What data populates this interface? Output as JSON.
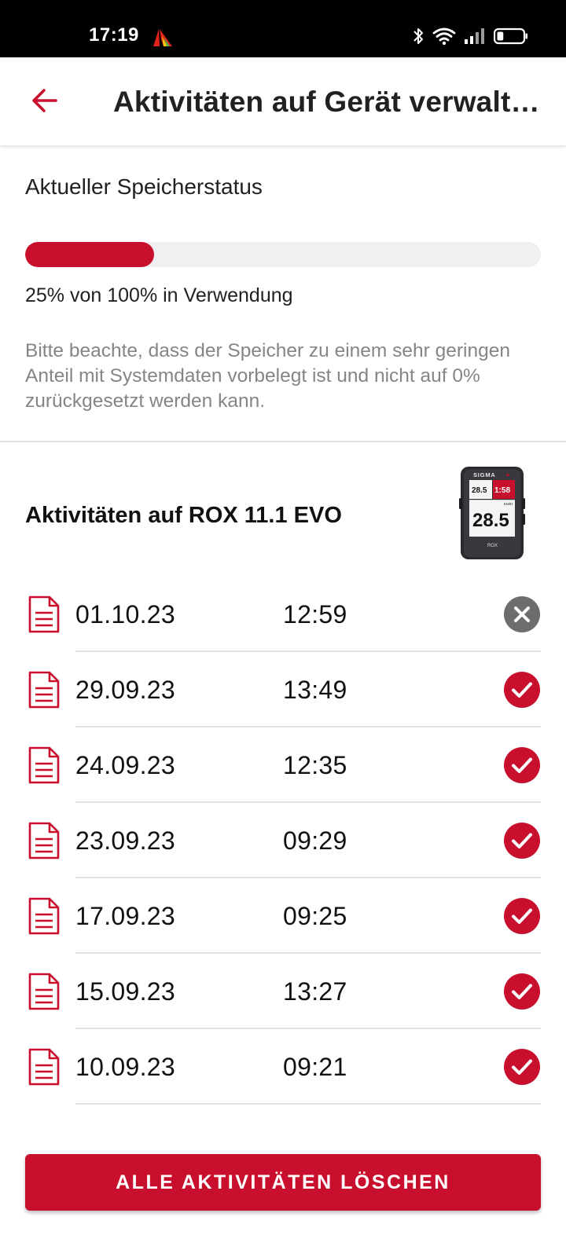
{
  "status_bar": {
    "time": "17:19",
    "app_icon": "altitude-triangle-icon",
    "icons": [
      "bluetooth-icon",
      "wifi-icon",
      "signal-icon",
      "battery-icon"
    ],
    "battery_level": 0.25
  },
  "app_bar": {
    "back_icon": "arrow-left-icon",
    "title": "Aktivitäten auf Gerät verwalt…"
  },
  "storage": {
    "heading": "Aktueller Speicherstatus",
    "usage_fraction": 0.25,
    "usage_text": "25% von 100% in Verwendung",
    "note": "Bitte beachte, dass der Speicher zu einem sehr geringen Anteil mit Systemdaten vorbelegt ist und nicht auf 0% zurückgesetzt werden kann."
  },
  "activities": {
    "heading": "Aktivitäten auf ROX 11.1 EVO",
    "device": {
      "brand": "SIGMA",
      "model_label": "ROX",
      "screen_values": [
        "28.5",
        "1:58",
        "28.5",
        "KM/H"
      ]
    },
    "items": [
      {
        "date": "01.10.23",
        "time": "12:59",
        "status": "not-synced",
        "status_icon": "close-circle-icon"
      },
      {
        "date": "29.09.23",
        "time": "13:49",
        "status": "synced",
        "status_icon": "check-circle-icon"
      },
      {
        "date": "24.09.23",
        "time": "12:35",
        "status": "synced",
        "status_icon": "check-circle-icon"
      },
      {
        "date": "23.09.23",
        "time": "09:29",
        "status": "synced",
        "status_icon": "check-circle-icon"
      },
      {
        "date": "17.09.23",
        "time": "09:25",
        "status": "synced",
        "status_icon": "check-circle-icon"
      },
      {
        "date": "15.09.23",
        "time": "13:27",
        "status": "synced",
        "status_icon": "check-circle-icon"
      },
      {
        "date": "10.09.23",
        "time": "09:21",
        "status": "synced",
        "status_icon": "check-circle-icon"
      }
    ]
  },
  "actions": {
    "delete_all_label": "ALLE AKTIVITÄTEN LÖSCHEN"
  },
  "colors": {
    "accent": "#c8102e",
    "track": "#f0f0f0",
    "muted_text": "#858585",
    "divider": "#e2e2e2",
    "not_synced": "#6d6d6d"
  }
}
